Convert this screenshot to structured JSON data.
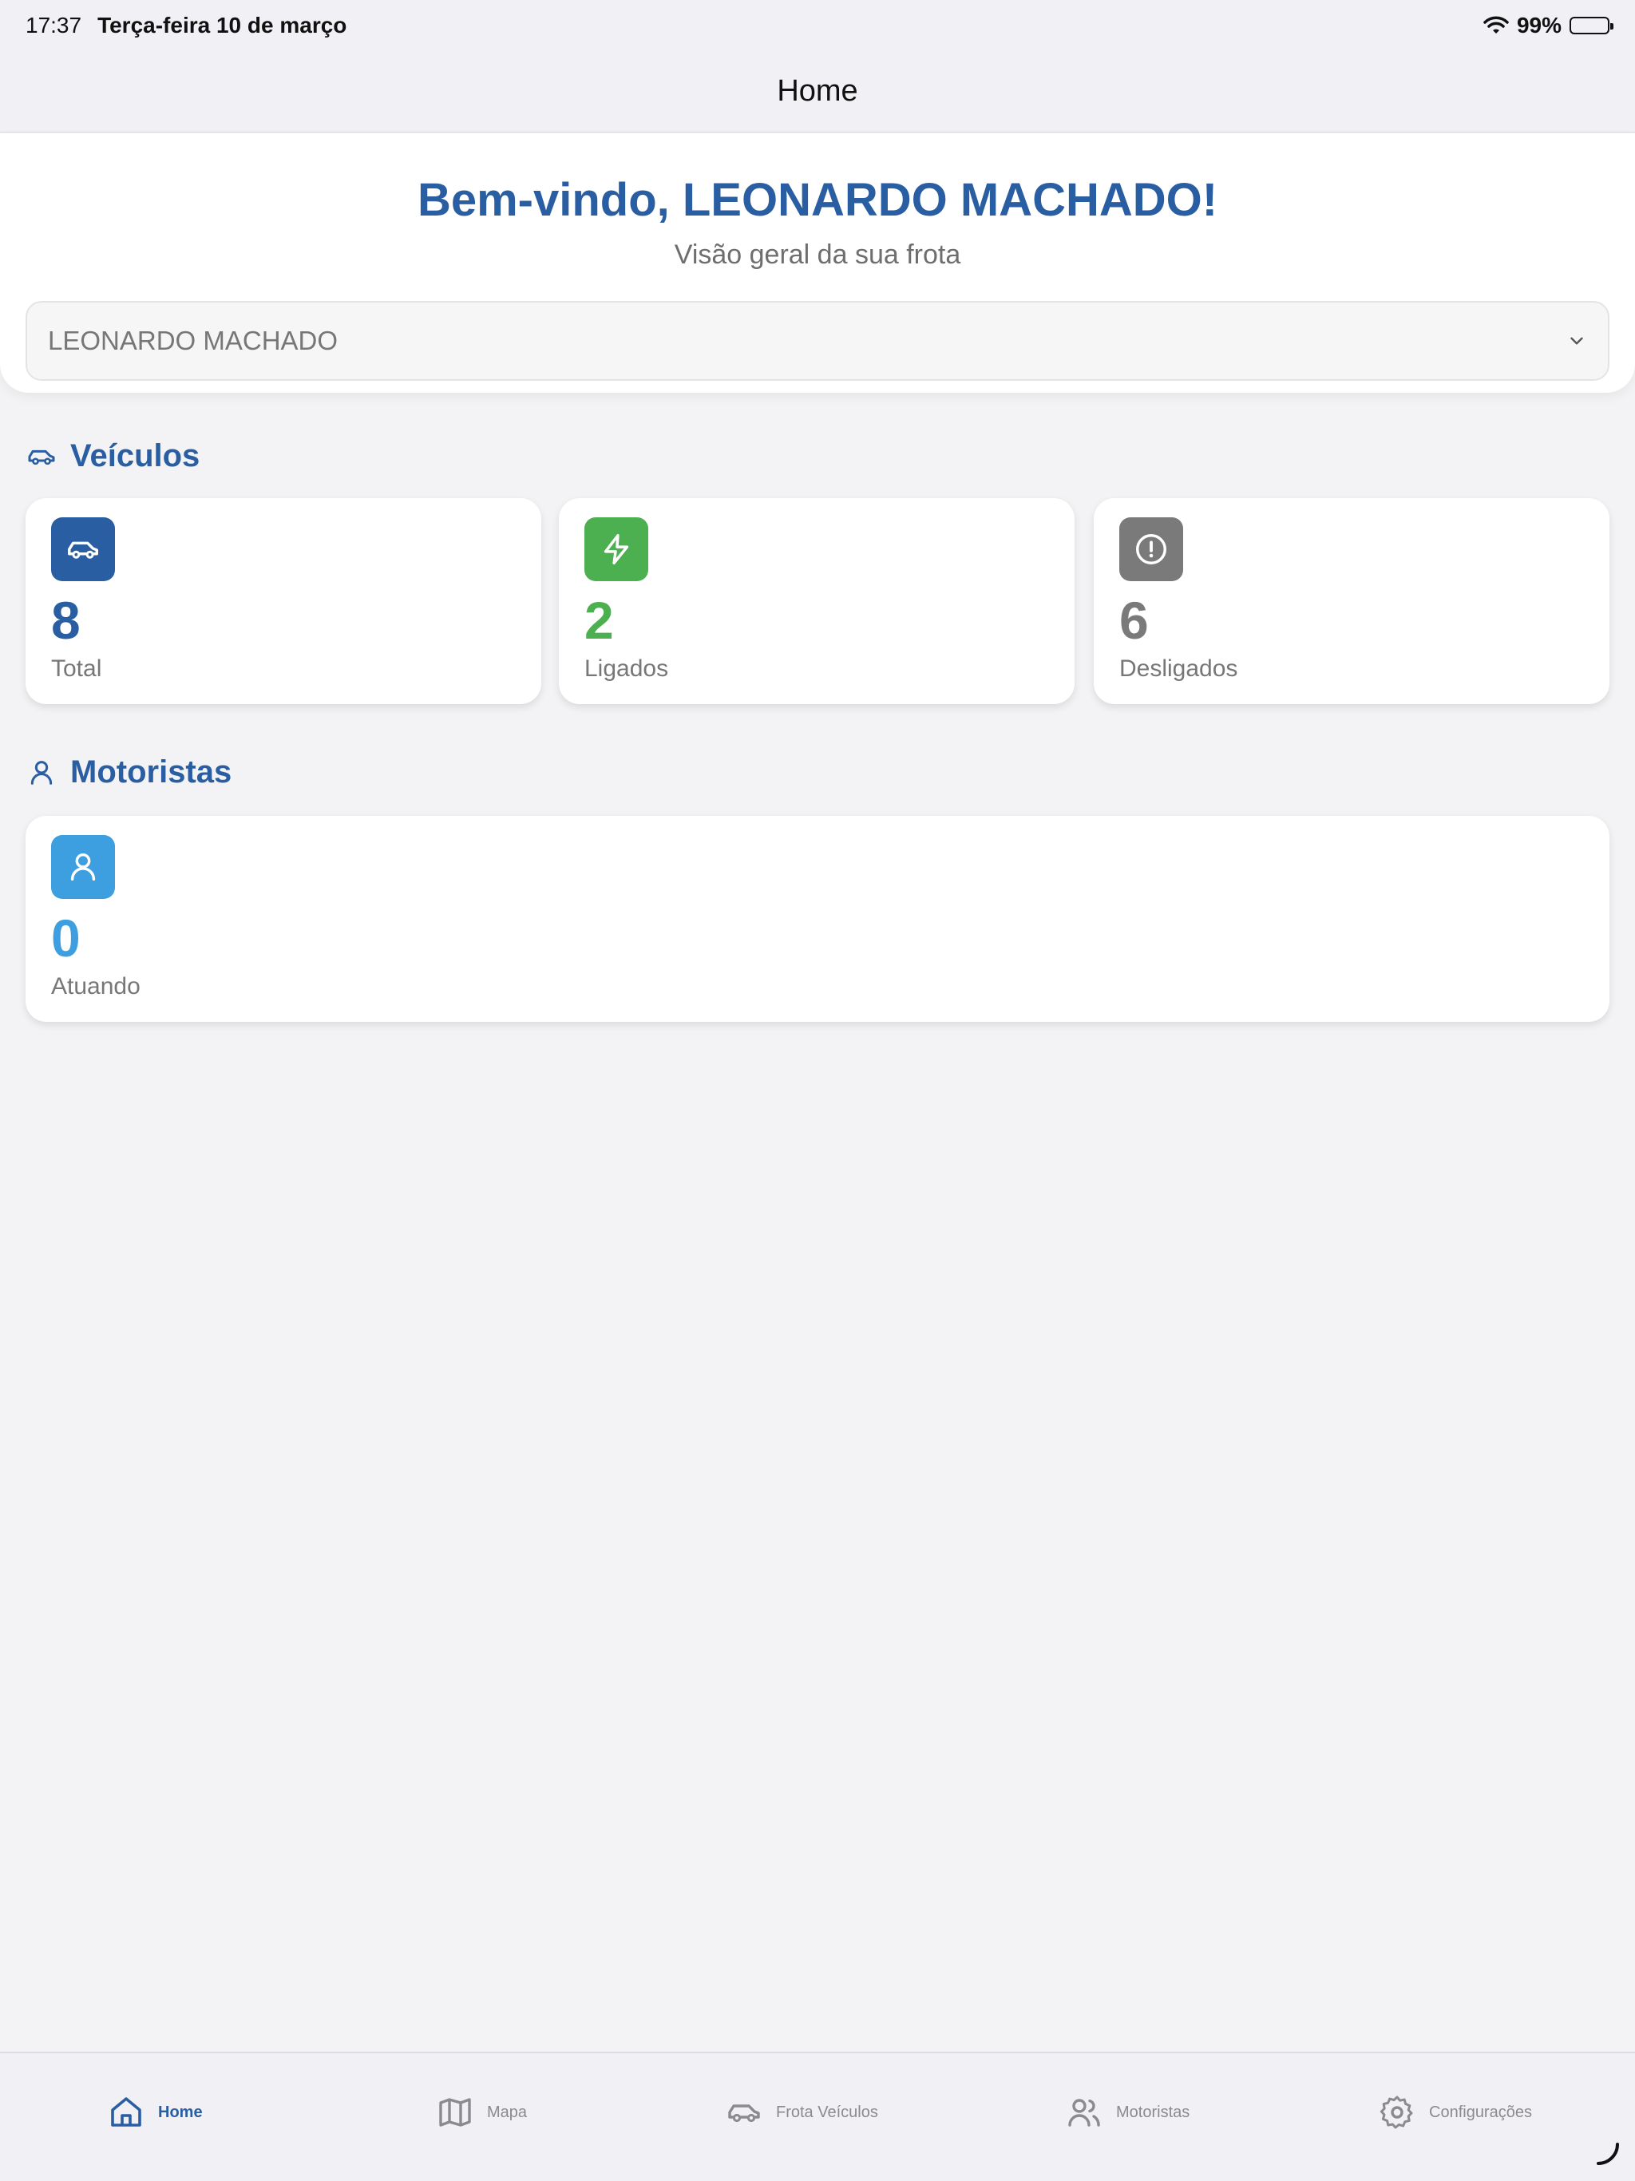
{
  "status_bar": {
    "time": "17:37",
    "date": "Terça-feira 10 de março",
    "battery": "99%"
  },
  "nav": {
    "title": "Home"
  },
  "welcome": {
    "title": "Bem-vindo, LEONARDO MACHADO!",
    "subtitle": "Visão geral da sua frota"
  },
  "owner_select": {
    "value": "LEONARDO MACHADO"
  },
  "vehicles": {
    "heading": "Veículos",
    "cards": [
      {
        "value": "8",
        "label": "Total",
        "color": "#2a5ea3"
      },
      {
        "value": "2",
        "label": "Ligados",
        "color": "#4caf50"
      },
      {
        "value": "6",
        "label": "Desligados",
        "color": "#7a7a7a"
      }
    ]
  },
  "drivers": {
    "heading": "Motoristas",
    "card": {
      "value": "0",
      "label": "Atuando",
      "color": "#3d9ee0"
    }
  },
  "tabs": [
    {
      "label": "Home",
      "icon": "home-icon",
      "active": true
    },
    {
      "label": "Mapa",
      "icon": "map-icon"
    },
    {
      "label": "Frota Veículos",
      "icon": "car-icon"
    },
    {
      "label": "Motoristas",
      "icon": "users-icon"
    },
    {
      "label": "Configurações",
      "icon": "gear-icon"
    }
  ],
  "colors": {
    "accent": "#2a5ea3",
    "green": "#4caf50",
    "gray": "#7a7a7a",
    "light_blue": "#3d9ee0"
  }
}
